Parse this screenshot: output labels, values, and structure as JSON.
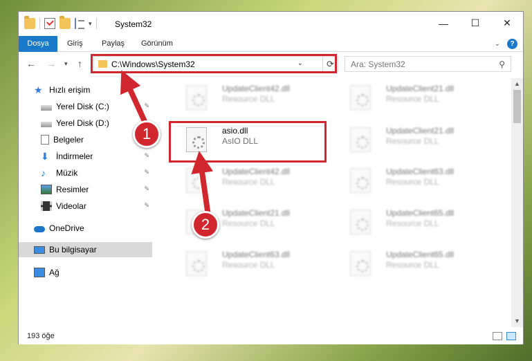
{
  "window": {
    "title": "System32",
    "controls": {
      "minimize": "—",
      "maximize": "☐",
      "close": "✕"
    }
  },
  "ribbon": {
    "tabs": [
      "Dosya",
      "Giriş",
      "Paylaş",
      "Görünüm"
    ],
    "collapse_icon": "chevron-down-icon",
    "help_label": "?"
  },
  "address": {
    "path": "C:\\Windows\\System32",
    "search_placeholder": "Ara: System32"
  },
  "sidebar": {
    "items": [
      {
        "label": "Hızlı erişim",
        "icon": "star-icon",
        "pinned": false
      },
      {
        "label": "Yerel Disk (C:)",
        "icon": "drive-icon",
        "pinned": true
      },
      {
        "label": "Yerel Disk (D:)",
        "icon": "drive-icon",
        "pinned": false
      },
      {
        "label": "Belgeler",
        "icon": "documents-icon",
        "pinned": true
      },
      {
        "label": "İndirmeler",
        "icon": "downloads-icon",
        "pinned": true
      },
      {
        "label": "Müzik",
        "icon": "music-icon",
        "pinned": true
      },
      {
        "label": "Resimler",
        "icon": "pictures-icon",
        "pinned": true
      },
      {
        "label": "Videolar",
        "icon": "videos-icon",
        "pinned": true
      },
      {
        "label": "OneDrive",
        "icon": "onedrive-icon",
        "pinned": false
      },
      {
        "label": "Bu bilgisayar",
        "icon": "computer-icon",
        "pinned": false,
        "selected": true
      },
      {
        "label": "Ağ",
        "icon": "network-icon",
        "pinned": false
      }
    ]
  },
  "files": {
    "highlighted": {
      "name": "asio.dll",
      "desc": "AsIO DLL"
    },
    "left_column": [
      {
        "name": "UpdateClient42.dll",
        "desc": "Resource DLL"
      },
      {
        "name": "UpdateClient42.dll",
        "desc": "Resource DLL"
      },
      {
        "name": "UpdateClient21.dll",
        "desc": "Resource DLL"
      },
      {
        "name": "UpdateClient63.dll",
        "desc": "Resource DLL"
      }
    ],
    "right_column": [
      {
        "name": "UpdateClient21.dll",
        "desc": "Resource DLL"
      },
      {
        "name": "UpdateClient21.dll",
        "desc": "Resource DLL"
      },
      {
        "name": "UpdateClient63.dll",
        "desc": "Resource DLL"
      },
      {
        "name": "UpdateClient65.dll",
        "desc": "Resource DLL"
      },
      {
        "name": "UpdateClient65.dll",
        "desc": "Resource DLL"
      }
    ]
  },
  "status": {
    "count": "193 öğe"
  },
  "annotations": {
    "step1": "1",
    "step2": "2",
    "accent": "#d2262e"
  }
}
